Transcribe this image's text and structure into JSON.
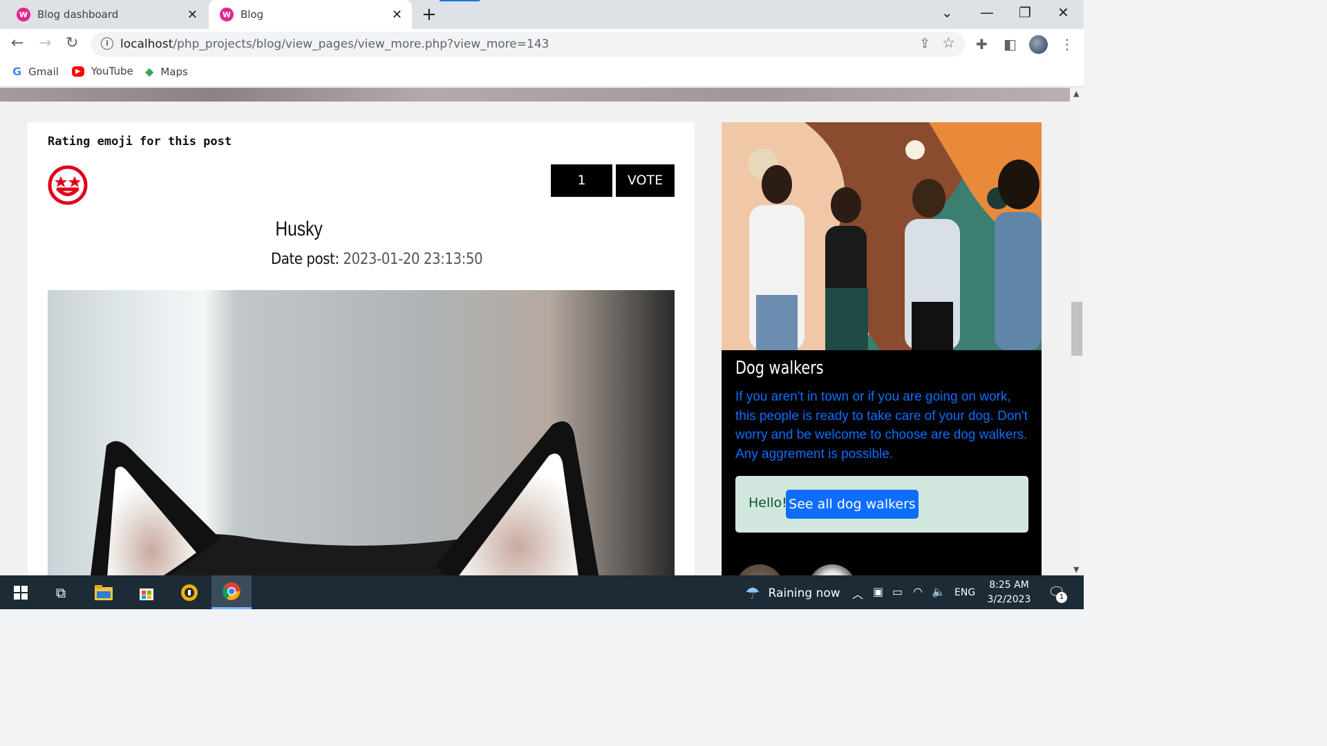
{
  "browser": {
    "tabs": [
      {
        "label": "Blog dashboard",
        "favicon": "W"
      },
      {
        "label": "Blog",
        "favicon": "W"
      }
    ],
    "url_host": "localhost",
    "url_path": "/php_projects/blog/view_pages/view_more.php?view_more=143",
    "bookmarks": [
      {
        "label": "Gmail",
        "icon": "G"
      },
      {
        "label": "YouTube",
        "icon": "▶"
      },
      {
        "label": "Maps",
        "icon": "◆"
      }
    ]
  },
  "post": {
    "rating_title": "Rating emoji for this post",
    "vote_count": "1",
    "vote_label": "VOTE",
    "title": "Husky",
    "date_label": "Date post:",
    "date_value": "2023-01-20 23:13:50"
  },
  "sidebar": {
    "title": "Dog walkers",
    "text": "If you aren't in town or if you are going on work, this people is ready to take care of your dog. Don't worry and be welcome to choose are dog walkers. Any aggrement is possible.",
    "alert_hello": "Hello!",
    "alert_button": "See all dog walkers"
  },
  "taskbar": {
    "weather": "Raining now",
    "language": "ENG",
    "time": "8:25 AM",
    "date": "3/2/2023",
    "notification_count": "1"
  },
  "colors": {
    "accent_blue": "#0d6efd",
    "emoji_red": "#e0001b",
    "alert_bg": "#d1e7dd"
  }
}
